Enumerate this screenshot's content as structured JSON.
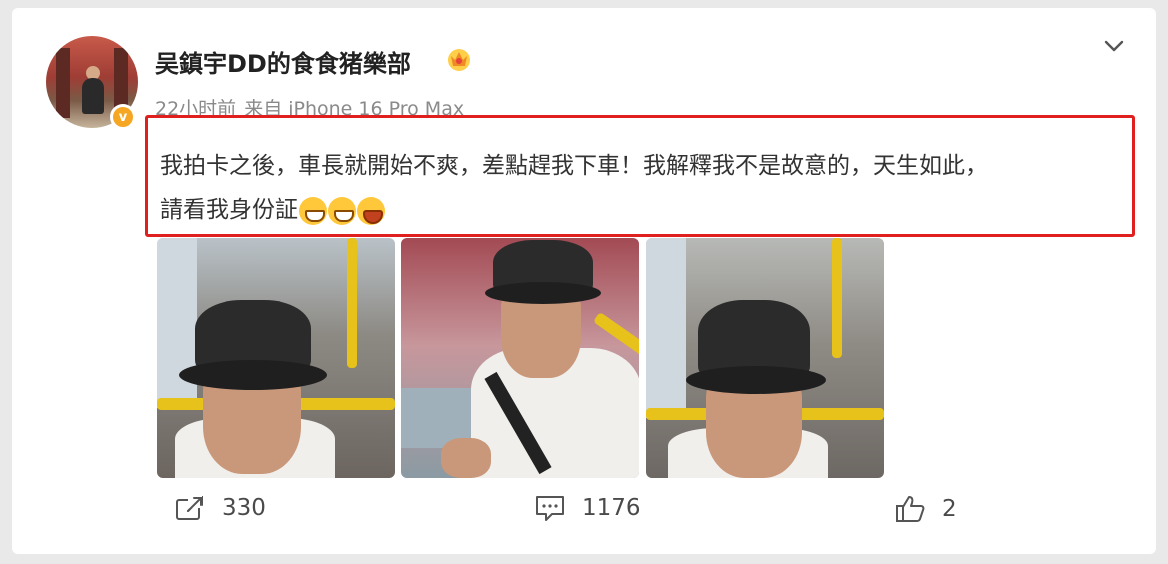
{
  "post": {
    "username": "吴鎮宇DD的食食猪樂部",
    "meta": {
      "time": "22小时前",
      "source": "来自 iPhone 16 Pro Max"
    },
    "text_line1": "我拍卡之後，車長就開始不爽，差點趕我下車！我解釋我不是故意的，天生如此，",
    "text_line2": "請看我身份証"
  },
  "actions": {
    "repost_count": "330",
    "comment_count": "1176",
    "like_count": "2"
  },
  "icons": {
    "crown": "crown-badge-icon",
    "verified": "verified-badge-icon",
    "more": "chevron-down-icon",
    "repost": "repost-icon",
    "comment": "comment-icon",
    "like": "thumbs-up-icon"
  },
  "colors": {
    "highlight_border": "#e0201e",
    "verified_badge": "#f5a623"
  }
}
